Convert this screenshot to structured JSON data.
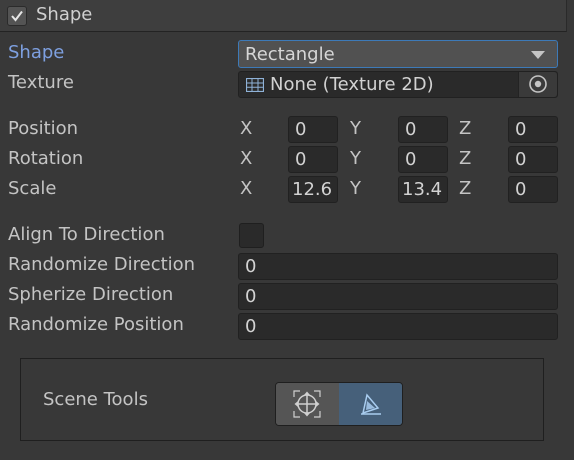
{
  "header": {
    "title": "Shape",
    "enabled": true
  },
  "fields": {
    "shape": {
      "label": "Shape",
      "value": "Rectangle"
    },
    "texture": {
      "label": "Texture",
      "value": "None (Texture 2D)"
    },
    "position": {
      "label": "Position",
      "x": "0",
      "y": "0",
      "z": "0"
    },
    "rotation": {
      "label": "Rotation",
      "x": "0",
      "y": "0",
      "z": "0"
    },
    "scale": {
      "label": "Scale",
      "x": "12.6",
      "y": "13.4",
      "z": "0"
    },
    "align_to_direction": {
      "label": "Align To Direction",
      "checked": false
    },
    "randomize_direction": {
      "label": "Randomize Direction",
      "value": "0"
    },
    "spherize_direction": {
      "label": "Spherize Direction",
      "value": "0"
    },
    "randomize_position": {
      "label": "Randomize Position",
      "value": "0"
    }
  },
  "axes": {
    "x": "X",
    "y": "Y",
    "z": "Z"
  },
  "scene_tools": {
    "label": "Scene Tools",
    "buttons": [
      {
        "icon": "transform-gizmo-icon",
        "active": false
      },
      {
        "icon": "shape-edit-icon",
        "active": true
      }
    ]
  },
  "colors": {
    "background": "#383838",
    "field": "#2a2a2a",
    "accent": "#3d7ab8",
    "active_label": "#7ea0e0"
  }
}
